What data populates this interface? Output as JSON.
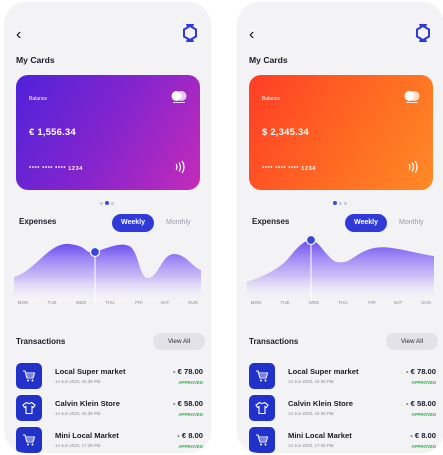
{
  "screens": [
    {
      "section_title": "My Cards",
      "card": {
        "label": "Balance",
        "amount": "€ 1,556.34",
        "number": "**** **** **** 1234",
        "gradient": [
          "#4f22d9",
          "#c52bb8"
        ]
      },
      "expenses": {
        "title": "Expenses",
        "tab_active": "Weekly",
        "tab_inactive": "Monthly",
        "selected_day": "WED"
      },
      "days": [
        "MON",
        "TUE",
        "WED",
        "THU",
        "FRI",
        "SAT",
        "SUN"
      ],
      "transactions_title": "Transactions",
      "view_all": "View All",
      "transactions": [
        {
          "icon": "cart-icon",
          "name": "Local Super market",
          "date": "14 Jun 2020, 15:35 PM",
          "amount": "- € 78.00",
          "status": "APPROVED"
        },
        {
          "icon": "shirt-icon",
          "name": "Calvin Klein Store",
          "date": "14 Jun 2020, 15:35 PM",
          "amount": "- € 58.00",
          "status": "APPROVED"
        },
        {
          "icon": "cart-icon",
          "name": "Mini Local Market",
          "date": "14 Jun 2020, 17:29 PM",
          "amount": "- € 8.00",
          "status": "APPROVED"
        }
      ]
    },
    {
      "section_title": "My Cards",
      "card": {
        "label": "Balance",
        "amount": "$ 2,345.34",
        "number": "**** **** **** 1234",
        "gradient": [
          "#ff3d26",
          "#ff8a27"
        ]
      },
      "expenses": {
        "title": "Expenses",
        "tab_active": "Weekly",
        "tab_inactive": "Monthly",
        "selected_day": "WED"
      },
      "days": [
        "MON",
        "TUE",
        "WED",
        "THU",
        "FRI",
        "SAT",
        "SUN"
      ],
      "transactions_title": "Transactions",
      "view_all": "View All",
      "transactions": [
        {
          "icon": "cart-icon",
          "name": "Local Super market",
          "date": "14 Jun 2020, 15:35 PM",
          "amount": "- € 78.00",
          "status": "APPROVED"
        },
        {
          "icon": "shirt-icon",
          "name": "Calvin Klein Store",
          "date": "14 Jun 2020, 15:35 PM",
          "amount": "- € 58.00",
          "status": "APPROVED"
        },
        {
          "icon": "cart-icon",
          "name": "Mini Local Market",
          "date": "14 Jun 2020, 17:29 PM",
          "amount": "- € 8.00",
          "status": "APPROVED"
        }
      ]
    }
  ],
  "colors": {
    "accent": "#2f3ad9",
    "approved": "#29b34b",
    "chart_fill_top": "#6b4df2"
  }
}
